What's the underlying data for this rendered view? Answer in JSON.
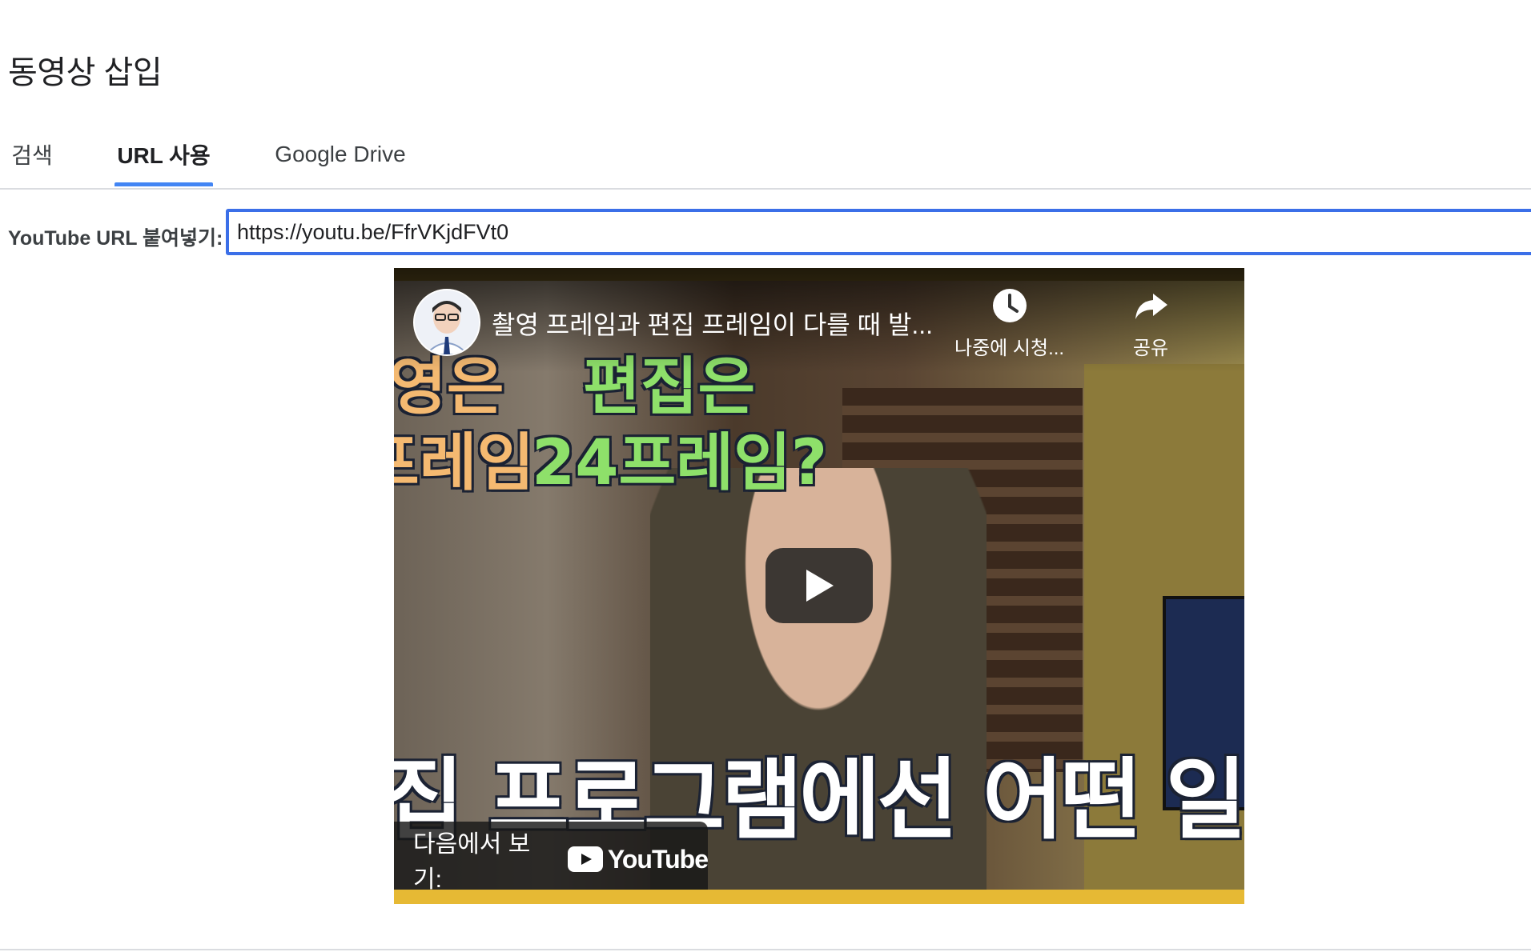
{
  "dialog": {
    "title": "동영상 삽입"
  },
  "tabs": [
    {
      "label": "검색",
      "active": false
    },
    {
      "label": "URL 사용",
      "active": true
    },
    {
      "label": "Google Drive",
      "active": false
    }
  ],
  "url_field": {
    "label": "YouTube URL 붙여넣기:",
    "value": "https://youtu.be/FfrVKjdFVt0"
  },
  "video": {
    "title": "촬영 프레임과 편집 프레임이 다를 때 발...",
    "watch_later_label": "나중에 시청...",
    "share_label": "공유",
    "watch_on_label": "다음에서 보기:",
    "youtube_wordmark": "YouTube",
    "captions": {
      "left_top": "영은",
      "left_bottom": "프레임",
      "right_top": "편집은",
      "right_bottom": "24프레임?",
      "bottom": "집 프로그램에선 어떤 일이..."
    }
  },
  "colors": {
    "accent": "#4285f4",
    "input_border": "#3b6fe8",
    "youtube_red": "#ff0000"
  }
}
